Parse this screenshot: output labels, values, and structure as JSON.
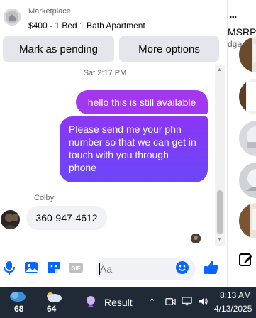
{
  "header": {
    "label": "Marketplace",
    "listing_title": "$400 - 1 Bed 1 Bath Apartment",
    "mark_pending_label": "Mark as pending",
    "more_options_label": "More options"
  },
  "conversation": {
    "timestamp": "Sat 2:17 PM",
    "outgoing": [
      "hello this is still available",
      "Please send me your phn number so that we can get in touch with you through phone"
    ],
    "sender_name": "Colby",
    "incoming": "360-947-4612"
  },
  "composer": {
    "placeholder": "Aa",
    "icons": [
      "microphone-icon",
      "photo-icon",
      "sticker-icon",
      "gif-icon",
      "emoji-icon",
      "like-icon"
    ],
    "gif_text": "GIF"
  },
  "side_panel": {
    "title": "MSRP",
    "subtitle": "dge",
    "more": "..."
  },
  "taskbar": {
    "weather_1": "68",
    "weather_2": "64",
    "app_label": "Result",
    "time": "8:13 AM",
    "date": "4/13/2025"
  },
  "colors": {
    "outgoing_bubble_start": "#a337f0",
    "outgoing_bubble_end": "#6a47f8",
    "accent_blue": "#0866ff",
    "taskbar": "#1f2a36"
  }
}
